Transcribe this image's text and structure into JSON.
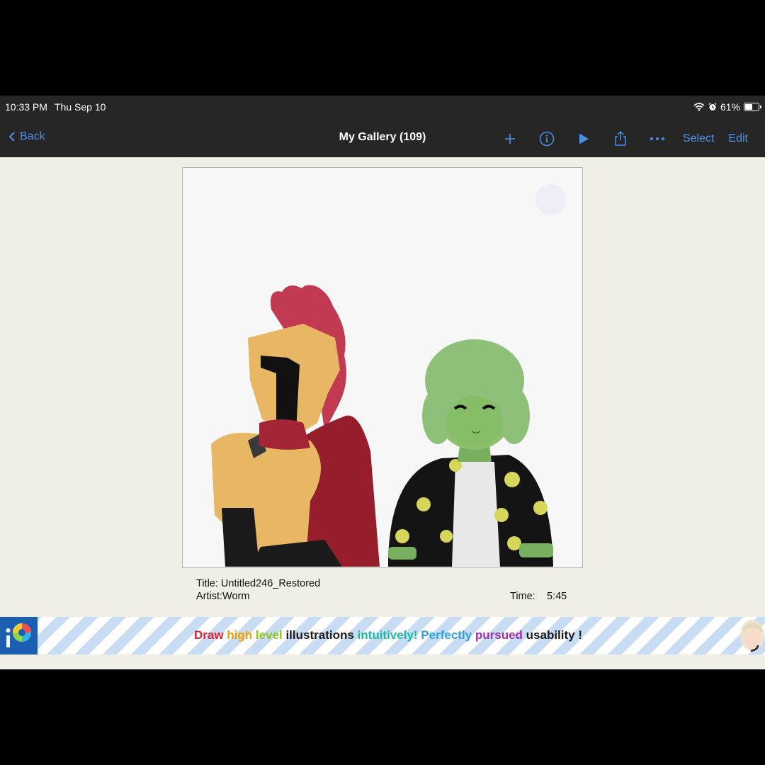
{
  "status": {
    "time": "10:33 PM",
    "date": "Thu Sep 10",
    "battery": "61%",
    "battery_level": 0.61
  },
  "nav": {
    "back": "Back",
    "title": "My Gallery (109)",
    "select": "Select",
    "edit": "Edit"
  },
  "icons": [
    "chevron-left-icon",
    "plus-icon",
    "info-icon",
    "play-icon",
    "share-icon",
    "more-icon",
    "wifi-icon",
    "alarm-icon",
    "battery-icon"
  ],
  "artwork": {
    "title_line": "Title: Untitled246_Restored",
    "artist_line": "Artist:Worm",
    "time_label": "Time:",
    "time_value": "5:45"
  },
  "banner": {
    "words": [
      {
        "text": "Draw",
        "color": "#d8262e"
      },
      {
        "text": "high",
        "color": "#f0a000"
      },
      {
        "text": "level",
        "color": "#8cc520"
      },
      {
        "text": "illustrations",
        "color": "#1a1a1a"
      },
      {
        "text": "intuitively!",
        "color": "#18b9a4"
      },
      {
        "text": "Perfectly",
        "color": "#2f9fe0"
      },
      {
        "text": "pursued",
        "color": "#9b2fb0"
      },
      {
        "text": "usability",
        "color": "#1a1a1a"
      },
      {
        "text": "!",
        "color": "#1a1a1a"
      }
    ]
  },
  "colors": {
    "accent": "#4e8fea",
    "bar": "#262626",
    "background": "#efefe6"
  }
}
